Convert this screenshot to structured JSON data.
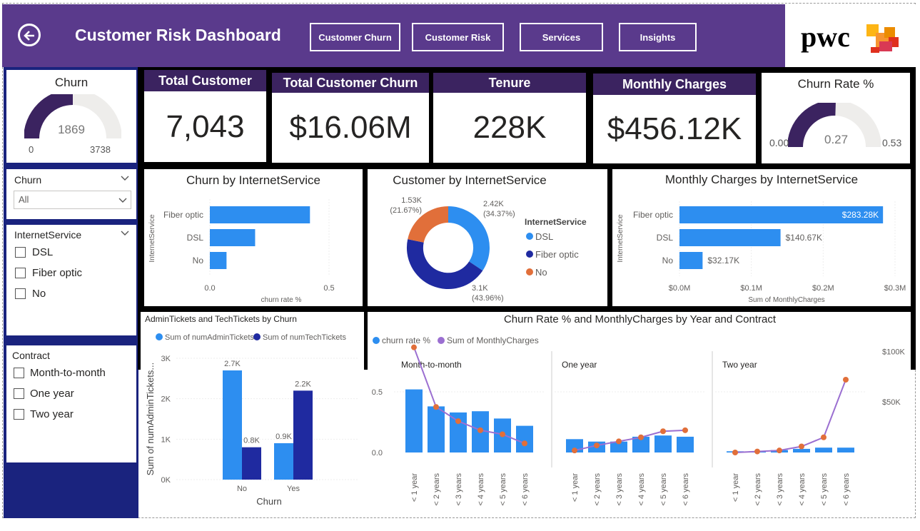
{
  "header": {
    "title": "Customer Risk Dashboard",
    "nav": [
      "Customer Churn",
      "Customer Risk",
      "Services",
      "Insights"
    ],
    "logo_text": "pwc"
  },
  "colors": {
    "purple": "#5a3a8c",
    "dark": "#3b2360",
    "navy": "#1a237e",
    "blue": "#2d8ef0",
    "darkblue": "#1f2aa0",
    "orange": "#e16f3a",
    "lavender": "#9b6fd1"
  },
  "gauge_churn": {
    "title": "Churn",
    "value": "1869",
    "min": "0",
    "max": "3738",
    "fraction": 0.5
  },
  "filters": {
    "churn": {
      "label": "Churn",
      "selected": "All"
    },
    "internet": {
      "label": "InternetService",
      "options": [
        "DSL",
        "Fiber optic",
        "No"
      ]
    },
    "contract": {
      "label": "Contract",
      "options": [
        "Month-to-month",
        "One year",
        "Two year"
      ]
    }
  },
  "kpis": [
    {
      "label": "Total Customer",
      "value": "7,043"
    },
    {
      "label": "Total Customer Churn",
      "value": "$16.06M"
    },
    {
      "label": "Tenure",
      "value": "228K"
    },
    {
      "label": "Monthly Charges",
      "value": "$456.12K"
    }
  ],
  "gauge_rate": {
    "title": "Churn Rate %",
    "value": "0.27",
    "min": "0.00",
    "max": "0.53",
    "fraction": 0.51
  },
  "charts": {
    "churn_internet": {
      "title": "Churn by InternetService",
      "ylabel": "InternetService",
      "xlabel": "churn rate %",
      "categories": [
        "Fiber optic",
        "DSL",
        "No"
      ],
      "ticks": [
        "0.0",
        "0.5"
      ]
    },
    "customer_internet": {
      "title": "Customer by InternetService",
      "legend_title": "InternetService",
      "legend": [
        "DSL",
        "Fiber optic",
        "No"
      ],
      "labels": [
        {
          "v": "2.42K",
          "p": "(34.37%)"
        },
        {
          "v": "3.1K",
          "p": "(43.96%)"
        },
        {
          "v": "1.53K",
          "p": "(21.67%)"
        }
      ]
    },
    "monthly_internet": {
      "title": "Monthly Charges by InternetService",
      "ylabel": "InternetService",
      "xlabel": "Sum of MonthlyCharges",
      "categories": [
        "Fiber optic",
        "DSL",
        "No"
      ],
      "value_labels": [
        "$283.28K",
        "$140.67K",
        "$32.17K"
      ],
      "ticks": [
        "$0.0M",
        "$0.1M",
        "$0.2M",
        "$0.3M"
      ]
    },
    "tickets": {
      "title": "AdminTickets and TechTickets by Churn",
      "legend": [
        "Sum of numAdminTickets",
        "Sum of numTechTickets"
      ],
      "ylabel": "Sum of numAdminTickets...",
      "xlabel": "Churn",
      "categories": [
        "No",
        "Yes"
      ],
      "ticks": [
        "0K",
        "1K",
        "2K",
        "3K"
      ],
      "value_labels": [
        "2.7K",
        "0.8K",
        "0.9K",
        "2.2K"
      ]
    },
    "combo": {
      "title": "Churn Rate % and  MonthlyCharges by Year and Contract",
      "legend": [
        "churn rate %",
        "Sum of MonthlyCharges"
      ],
      "panels": [
        "Month-to-month",
        "One year",
        "Two year"
      ],
      "xcats": [
        "< 1 year",
        "< 2 years",
        "< 3 years",
        "< 4 years",
        "< 5 years",
        "< 6 years"
      ],
      "yticks_left": [
        "0.0",
        "0.5"
      ],
      "yticks_right": [
        "$50K",
        "$100K"
      ]
    }
  },
  "chart_data": [
    {
      "type": "bar",
      "title": "Churn by InternetService",
      "categories": [
        "Fiber optic",
        "DSL",
        "No"
      ],
      "values": [
        0.42,
        0.19,
        0.07
      ],
      "xlabel": "churn rate %",
      "ylabel": "InternetService",
      "xlim": [
        0,
        0.5
      ]
    },
    {
      "type": "pie",
      "title": "Customer by InternetService",
      "categories": [
        "DSL",
        "Fiber optic",
        "No"
      ],
      "values": [
        2420,
        3100,
        1530
      ],
      "percent": [
        34.37,
        43.96,
        21.67
      ]
    },
    {
      "type": "bar",
      "title": "Monthly Charges by InternetService",
      "categories": [
        "Fiber optic",
        "DSL",
        "No"
      ],
      "values": [
        283280,
        140670,
        32170
      ],
      "xlabel": "Sum of MonthlyCharges",
      "ylabel": "InternetService",
      "xlim": [
        0,
        300000
      ]
    },
    {
      "type": "bar",
      "title": "AdminTickets and TechTickets by Churn",
      "categories": [
        "No",
        "Yes"
      ],
      "series": [
        {
          "name": "Sum of numAdminTickets",
          "values": [
            2700,
            900
          ]
        },
        {
          "name": "Sum of numTechTickets",
          "values": [
            800,
            2200
          ]
        }
      ],
      "xlabel": "Churn",
      "ylim": [
        0,
        3000
      ]
    },
    {
      "type": "bar",
      "title": "Churn Rate % and  MonthlyCharges by Year and Contract",
      "categories": [
        "< 1 year",
        "< 2 years",
        "< 3 years",
        "< 4 years",
        "< 5 years",
        "< 6 years"
      ],
      "series": [
        {
          "name": "churn rate %",
          "panel": "Month-to-month",
          "values": [
            0.52,
            0.38,
            0.33,
            0.34,
            0.28,
            0.22
          ]
        },
        {
          "name": "Sum of MonthlyCharges",
          "panel": "Month-to-month",
          "values": [
            104000,
            45000,
            31000,
            22000,
            18000,
            9000
          ]
        },
        {
          "name": "churn rate %",
          "panel": "One year",
          "values": [
            0.11,
            0.09,
            0.09,
            0.13,
            0.14,
            0.13
          ]
        },
        {
          "name": "Sum of MonthlyCharges",
          "panel": "One year",
          "values": [
            2000,
            7000,
            11000,
            15000,
            21000,
            22000
          ]
        },
        {
          "name": "churn rate %",
          "panel": "Two year",
          "values": [
            0.01,
            0.01,
            0.02,
            0.03,
            0.04,
            0.04
          ]
        },
        {
          "name": "Sum of MonthlyCharges",
          "panel": "Two year",
          "values": [
            0,
            1000,
            2000,
            6000,
            15000,
            72000
          ]
        }
      ]
    }
  ]
}
